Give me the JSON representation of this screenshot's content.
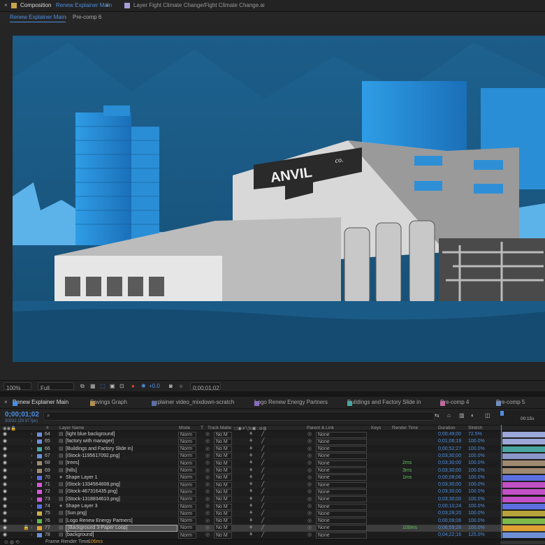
{
  "panel_top": {
    "close_glyph": "×",
    "comp_prefix": "Composition",
    "comp_name": "Renew Explainer Main",
    "menu_glyph": "≡",
    "layer_tab": "Layer Fight Climate Change/Fight Climate Change.ai"
  },
  "comp_tabs": {
    "active": "Renew Explainer Main",
    "sep": "‹",
    "second": "Pre-comp 6"
  },
  "logo_text": "ANVIL",
  "logo_suffix": "co.",
  "viewer_bar": {
    "zoom": "100%",
    "resolution": "Full",
    "exposure": "+0.0",
    "timecode": "0;00;01;02"
  },
  "timeline_tabs": [
    "Renew Explainer Main",
    "Savings Graph",
    "explainer video_mixdown-scratch",
    "Logo Renew Energy Partners",
    "Buildings and Factory Slide in",
    "Pre-comp 4",
    "Pre-comp 5"
  ],
  "timeline_tab_colors": [
    "#4a8fdd",
    "#b48e52",
    "#5b6fb0",
    "#8a6bc0",
    "#4aa6a0",
    "#c06b9f",
    "#6f8fc0"
  ],
  "timeline": {
    "current_time": "0;00;01;02",
    "frame_info": "00032 (29.97 fps)",
    "search_icon": "search-icon",
    "ruler_label": "00:15s"
  },
  "columns": {
    "layer_name": "Layer Name",
    "mode": "Mode",
    "t": "T",
    "track_matte": "Track Matte",
    "parent": "Parent & Link",
    "keys": "Keys",
    "render_time": "Render Time",
    "duration": "Duration",
    "stretch": "Stretch",
    "hash": "#"
  },
  "layers": [
    {
      "num": "64",
      "name": "[light blue background]",
      "color": "#6e8fd6",
      "mode": "Norm",
      "matte": "No M",
      "parent": "None",
      "render": "",
      "duration": "0;00;49;00",
      "stretch": "72.5%",
      "bar": "#9aa7d8"
    },
    {
      "num": "65",
      "name": "[factory with manager]",
      "color": "#6e8fd6",
      "mode": "Norm",
      "matte": "No M",
      "parent": "None",
      "render": "",
      "duration": "0;01;06;19",
      "stretch": "100.0%",
      "bar": "#9aa7d8"
    },
    {
      "num": "66",
      "name": "[Buildings and Factory Slide in]",
      "color": "#4aa6a0",
      "mode": "Norm",
      "matte": "No M",
      "parent": "None",
      "render": "",
      "duration": "0;00;52;27",
      "stretch": "100.0%",
      "bar": "#4aa6a0"
    },
    {
      "num": "67",
      "name": "[iStock-1195617092.png]",
      "color": "#6e8fd6",
      "mode": "Norm",
      "matte": "No M",
      "parent": "None",
      "render": "",
      "duration": "0;03;30;00",
      "stretch": "100.0%",
      "bar": "#8b96c9"
    },
    {
      "num": "68",
      "name": "[trees]",
      "color": "#a08a72",
      "mode": "Norm",
      "matte": "No M",
      "parent": "None",
      "render": "2ms",
      "duration": "0;03;30;00",
      "stretch": "100.0%",
      "bar": "#a08a72"
    },
    {
      "num": "69",
      "name": "[hills]",
      "color": "#a08a72",
      "mode": "Norm",
      "matte": "No M",
      "parent": "None",
      "render": "3ms",
      "duration": "0;03;30;00",
      "stretch": "100.0%",
      "bar": "#a08a72"
    },
    {
      "num": "70",
      "name": "Shape Layer 1",
      "color": "#5b6fe0",
      "mode": "Norm",
      "matte": "No M",
      "parent": "None",
      "render": "1ms",
      "duration": "0;00;08;06",
      "stretch": "100.0%",
      "bar": "#5b6fe0"
    },
    {
      "num": "71",
      "name": "[iStock-1334564608.png]",
      "color": "#d35bd6",
      "mode": "Norm",
      "matte": "No M",
      "parent": "None",
      "render": "",
      "duration": "0;03;30;00",
      "stretch": "100.0%",
      "bar": "#c24fc6"
    },
    {
      "num": "72",
      "name": "[iStock-467316435.png]",
      "color": "#d35bd6",
      "mode": "Norm",
      "matte": "No M",
      "parent": "None",
      "render": "",
      "duration": "0;03;30;00",
      "stretch": "100.0%",
      "bar": "#c24fc6"
    },
    {
      "num": "73",
      "name": "[iStock-1318834610.png]",
      "color": "#d35bd6",
      "mode": "Norm",
      "matte": "No M",
      "parent": "None",
      "render": "",
      "duration": "0;03;30;00",
      "stretch": "100.0%",
      "bar": "#c24fc6"
    },
    {
      "num": "74",
      "name": "Shape Layer 3",
      "color": "#5b6fe0",
      "mode": "Norm",
      "matte": "No M",
      "parent": "None",
      "render": "",
      "duration": "0;00;10;24",
      "stretch": "100.0%",
      "bar": "#5b6fe0"
    },
    {
      "num": "75",
      "name": "[Sun.png]",
      "color": "#c9b24a",
      "mode": "Norm",
      "matte": "No M",
      "parent": "None",
      "render": "",
      "duration": "0;03;28;20",
      "stretch": "100.0%",
      "bar": "#b8a33a"
    },
    {
      "num": "76",
      "name": "[Logo Renew Energy Partners]",
      "color": "#5fb84a",
      "mode": "Norm",
      "matte": "No M",
      "parent": "None",
      "render": "",
      "duration": "0;00;09;06",
      "stretch": "100.0%",
      "bar": "#7fb84a"
    },
    {
      "num": "77",
      "name": "[Background 3-Paper Loop]",
      "color": "#e0a032",
      "mode": "Norm",
      "matte": "No M",
      "parent": "None",
      "render": "100ms",
      "duration": "0;06;59;28",
      "stretch": "100.0%",
      "bar": "#e0a032",
      "selected": true
    },
    {
      "num": "78",
      "name": "[background]",
      "color": "#6e8fd6",
      "mode": "Norm",
      "matte": "No M",
      "parent": "None",
      "render": "",
      "duration": "0;04;22;16",
      "stretch": "125.0%",
      "bar": "#6e8fd6"
    }
  ],
  "status": {
    "label": "Frame Render Time",
    "value": "106ms"
  }
}
